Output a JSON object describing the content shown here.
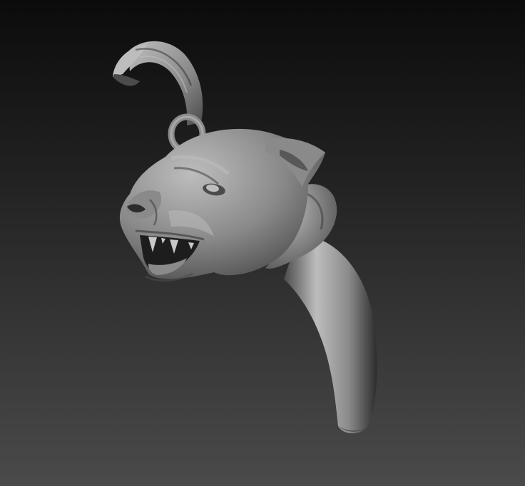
{
  "scene": {
    "subject_icon": "panther-head-fang-pendant-icon",
    "colors": {
      "background_top": "#0b0b0b",
      "background_bottom": "#4a4a4a",
      "clay_highlight": "#bdbdbd",
      "clay_mid": "#8a8a8a",
      "clay_shadow": "#4b4b4b",
      "clay_deep": "#2c2c2c",
      "mouth_dark": "#1d1d1d",
      "tooth": "#c9c9c9"
    }
  }
}
